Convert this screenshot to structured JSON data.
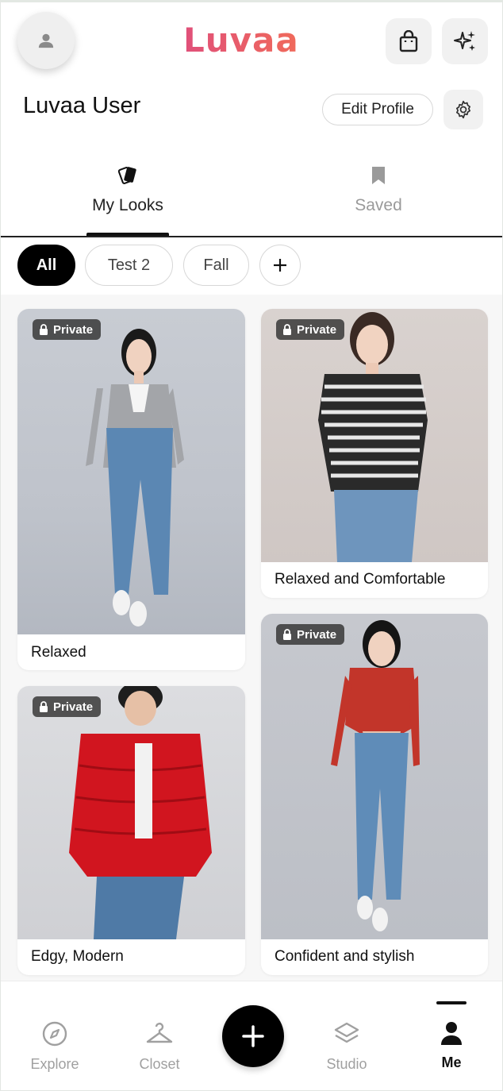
{
  "header": {
    "logo_text": "Luvaa",
    "user_name": "Luvaa User",
    "edit_profile_label": "Edit Profile"
  },
  "tabs": [
    {
      "label": "My Looks",
      "icon": "cards-icon",
      "active": true
    },
    {
      "label": "Saved",
      "icon": "bookmark-icon",
      "active": false
    }
  ],
  "filters": {
    "chips": [
      "All",
      "Test 2",
      "Fall"
    ],
    "active": "All",
    "add_icon": "plus-icon"
  },
  "looks": [
    {
      "badge": "Private",
      "caption": "Relaxed",
      "outfit": "grey blazer, white top, blue skinny jeans, white sneakers"
    },
    {
      "badge": "Private",
      "caption": "Relaxed and Comfortable",
      "outfit": "black and white striped cold-shoulder top, blue jeans"
    },
    {
      "badge": "Private",
      "caption": "Edgy, Modern",
      "outfit": "red puffer jacket, white tank, blue jeans"
    },
    {
      "badge": "Private",
      "caption": "Confident and stylish",
      "outfit": "red patterned cut-out top, blue skinny jeans, white sneakers"
    }
  ],
  "bottom_nav": [
    {
      "label": "Explore",
      "icon": "compass-icon",
      "active": false
    },
    {
      "label": "Closet",
      "icon": "hanger-icon",
      "active": false
    },
    {
      "label": "Studio",
      "icon": "layers-icon",
      "active": false
    },
    {
      "label": "Me",
      "icon": "person-icon",
      "active": true
    }
  ],
  "colors": {
    "brand_gradient_start": "#e0507a",
    "brand_gradient_end": "#f06a5a",
    "active_chip": "#000000",
    "inactive_text": "#9a9a9a"
  }
}
